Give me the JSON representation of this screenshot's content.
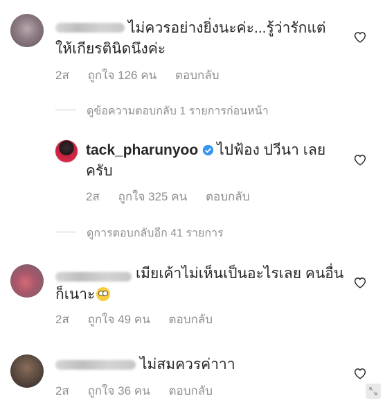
{
  "comments": [
    {
      "text_line1": "ไม่ควรอย่างยิ่งนะค่ะ...รู้ว่ารักแต่",
      "text_line2": "ให้เกียรตินิดนึงค่ะ",
      "time": "2ส",
      "likes": "ถูกใจ 126 คน",
      "reply": "ตอบกลับ"
    },
    {
      "username": "tack_pharunyoo",
      "text_line1": "ไปฟ้อง ปวีนา เลย",
      "text_line2": "ครับ",
      "time": "2ส",
      "likes": "ถูกใจ 325 คน",
      "reply": "ตอบกลับ"
    },
    {
      "text_line1": "เมียเค้าไม่เห็นเป็นอะไรเลย คนอื่น",
      "text_line2": "ก็เนาะ",
      "time": "2ส",
      "likes": "ถูกใจ 49 คน",
      "reply": "ตอบกลับ"
    },
    {
      "text_line1": "ไม่สมควรค่าาา",
      "time": "2ส",
      "likes": "ถูกใจ 36 คน",
      "reply": "ตอบกลับ"
    }
  ],
  "view_previous_replies": "ดูข้อความตอบกลับ 1 รายการก่อนหน้า",
  "view_more_replies": "ดูการตอบกลับอีก 41 รายการ",
  "colors": {
    "text": "#262626",
    "secondary": "#8e8e8e",
    "verified": "#3897f0"
  }
}
